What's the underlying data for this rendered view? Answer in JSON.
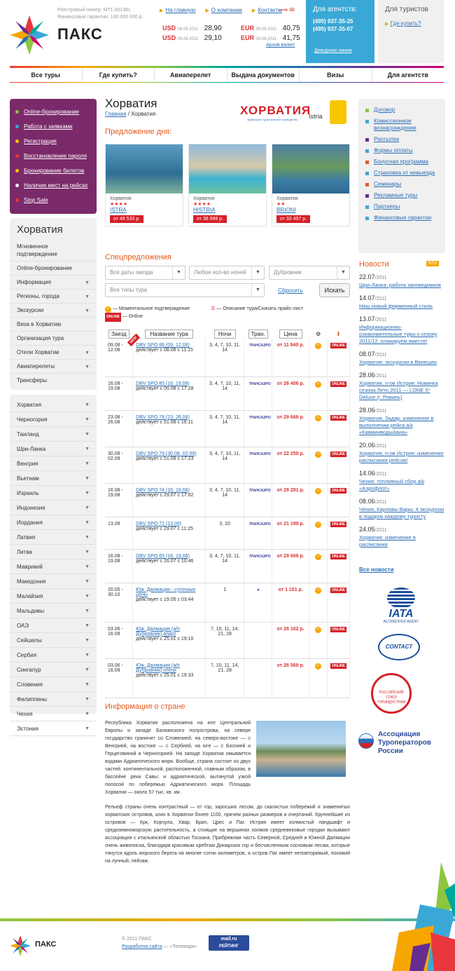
{
  "header": {
    "brand": "ПАКС",
    "reg1": "Реестровый номер: МТ1 001381",
    "reg2": "Финансовые гарантии: 100 000 000 р.",
    "links": [
      "На главную",
      "О компании",
      "Контакты"
    ],
    "rates": [
      {
        "cur": "USD",
        "date": "08.08.2011",
        "val": "28,90"
      },
      {
        "cur": "USD",
        "date": "09.08.2011",
        "val": "29,10"
      },
      {
        "cur": "EUR",
        "date": "08.08.2011",
        "val": "40,75"
      },
      {
        "cur": "EUR",
        "date": "09.08.2011",
        "val": "41,75"
      }
    ],
    "archive": "Архив валют",
    "agency": {
      "title": "Для агентств:",
      "phone1": "(495) 937-35-25",
      "phone2": "(495) 937-35-07",
      "hotline": "Дежурная линия"
    },
    "tourists": {
      "title": "Для туристов",
      "link": "Где купить?"
    }
  },
  "nav": [
    "Все туры",
    "Где купить?",
    "Авиаперелет",
    "Выдача документов",
    "Визы",
    "Для агентств"
  ],
  "leftbox": [
    "Online-бронирование",
    "Работа с заявками",
    "Регистрация",
    "Восстановление пароля",
    "Бронирование билетов",
    "Наличие мест на рейсах",
    "Stop Sale"
  ],
  "country_menu": {
    "title": "Хорватия",
    "items": [
      "Мгновенное подтверждение",
      "Online-бронирование",
      "Информация",
      "Регионы, города",
      "Экскурсии",
      "Виза в Хорватию",
      "Организация тура",
      "Отели Хорватии",
      "Авиаперелеты",
      "Трансферы"
    ]
  },
  "countries": [
    "Хорватия",
    "Черногория",
    "Таиланд",
    "Шри-Ланка",
    "Венгрия",
    "Вьетнам",
    "Израиль",
    "Индонезия",
    "Иордания",
    "Латвия",
    "Литва",
    "Маврикий",
    "Македония",
    "Малайзия",
    "Мальдивы",
    "ОАЭ",
    "Сейшелы",
    "Сербия",
    "Сингапур",
    "Словения",
    "Филиппины",
    "Чехия",
    "Эстония"
  ],
  "main": {
    "title": "Хорватия",
    "crumb_home": "Главная",
    "crumb_sep": "/",
    "crumb_current": "Хорватия",
    "badge1": "ХОРВАТИЯ",
    "badge1_sub": "хорватское туристическое сообщество",
    "badge2": "Istria",
    "offer_title": "Предложение дня:",
    "offers": [
      {
        "country": "Хорватия",
        "stars": "★★★★",
        "name": "ISTRA",
        "price": "от 48 533 р."
      },
      {
        "country": "Хорватия",
        "stars": "★★★★",
        "name": "HISTRIA",
        "price": "от 38 998 р."
      },
      {
        "country": "Хорватия",
        "stars": "★★",
        "name": "BRIONI",
        "price": "от 33 497 р."
      }
    ],
    "special_title": "Спецпредложения",
    "filters": {
      "dates": "Все даты заезда",
      "nights": "Любое кол-во ночей",
      "city": "Дубровник",
      "types": "Все типы тура",
      "reset": "Сбросить",
      "search": "Искать"
    },
    "legend": {
      "instant": "— Моментальное подтверждение",
      "desc": "— Описание тура/Скачать прайс-лист",
      "online": "— Online"
    },
    "table_headers": [
      "Заезд",
      "Название тура",
      "Ночи",
      "Тран.",
      "Цена"
    ],
    "rows": [
      {
        "date": "09.08 - 12.08",
        "tour": "DBV SPO 86 (09. 12.08)",
        "note": "действует с 08.08 с 11:15",
        "nights": "3, 4, 7, 10, 11, 14",
        "air": "ТРАНСАЭРО",
        "price": "от 11 940 р.",
        "check": true
      },
      {
        "date": "16.08 - 19.08",
        "tour": "DBV SPO 85 (16. 19.08)",
        "note": "действует с 05.08 с 17:28",
        "nights": "3, 4, 7, 10, 11, 14",
        "air": "ТРАНСАЭРО",
        "price": "от 26 406 р.",
        "check": true
      },
      {
        "date": "23.08 - 26.08",
        "tour": "DBV SPO 78 (23. 26.08)",
        "note": "действует с 01.08 с 16:11",
        "nights": "3, 4, 7, 10, 11, 14",
        "air": "ТРАНСАЭРО",
        "price": "от 29 666 р.",
        "check": true
      },
      {
        "date": "30.08 - 02.09",
        "tour": "DBV SPO 79 (30.08. 02.09)",
        "note": "действует с 01.08 с 17:23",
        "nights": "3, 4, 7, 10, 11, 14",
        "air": "ТРАНСАЭРО",
        "price": "от 22 250 р.",
        "check": true
      },
      {
        "date": "16.08 - 19.08",
        "tour": "DBV SPO 74 (16. 19.08)",
        "note": "действует с 29.07 с 17:02",
        "nights": "3, 4, 7, 10, 11, 14",
        "air": "ТРАНСАЭРО",
        "price": "от 28 281 р.",
        "check": true
      },
      {
        "date": "13.09",
        "tour": "DBV SPO 71 (13.09)",
        "note": "действует с 29.07 с 11:25",
        "nights": "3, 10",
        "air": "ТРАНСАЭРО",
        "price": "от 21 190 р.",
        "check": true
      },
      {
        "date": "16.08 - 19.08",
        "tour": "DBV SPO 65 (16. 19.08)",
        "note": "действует с 26.07 с 10:46",
        "nights": "3, 4, 7, 10, 11, 14",
        "air": "ТРАНСАЭРО",
        "price": "от 29 666 р.",
        "check": true
      },
      {
        "date": "20.05 - 30.10",
        "tour": "Юж. Далмация - суточные цены",
        "note": "действует с 19.05 с 03:44",
        "nights": "1",
        "air": "✈",
        "price": "от 1 101 р.",
        "check": true
      },
      {
        "date": "03.06 - 16.09",
        "tour": "Юж. Далмация (а/п Дубровник) апарт",
        "note": "действует с 25.01 с 19:10",
        "nights": "7, 10, 11, 14, 21, 28",
        "air": "",
        "price": "от 26 162 р.",
        "check": true
      },
      {
        "date": "03.06 - 16.09",
        "tour": "Юж. Далмация (а/п Дубровник) отели",
        "note": "действует с 25.01 с 19:33",
        "nights": "7, 10, 11, 14, 21, 28",
        "air": "",
        "price": "от 26 569 р.",
        "check": true
      }
    ],
    "online_label": "ONLINE",
    "new_label": "NEW",
    "country_info_title": "Информация о стране",
    "country_text1": "Республика Хорватия расположена на юге Центральной Европы и западе Балканского полуострова, на севере государство граничит со Словенией, на северо-востоке — с Венгрией, на востоке — с Сербией, на юге — с Боснией и Герцеговиной и Черногорией. На западе Хорватия омывается водами Адриатического моря. Вообще, страна состоит из двух частей: континентальной, расположенной, главным образом, в бассейне реки Савы; и адриатической, вытянутой узкой полосой по побережью Адриатического моря. Площадь Хорватии — около 57 тыс. кв. км.",
    "country_text2": "Рельеф страны очень контрастный — от гор, заросших лесом, до скалистых побережий и знаменитых хорватских островов, коих в Хорватии более 1100, причем разных размеров и очертаний. Крупнейшие из островов — Крк, Корчула, Хвар, Брач, Црес и Паг. Истрия имеет холмистый ландшафт и средиземноморскую растительность, а стоящие на вершинах холмов средневековые городки вызывают ассоциации с итальянской областью Тоскана. Прибрежная часть Северной, Средней и Южной Далмации очень живописна, благодаря красивым хребтам Динарских гор и бесчисленным сосновым лесам, которые тянутся вдоль морского берега на многие сотни километров, а остров Паг имеет неповторимый, похожий на лунный, пейзаж."
  },
  "right_links": [
    "Договор",
    "Комиссионное вознаграждение",
    "Рассылка",
    "Формы оплаты",
    "Бонусная программа",
    "Страховка от невыезда",
    "Семинары",
    "Рекламные туры",
    "Партнеры",
    "Финансовые гарантии"
  ],
  "news": {
    "title": "Новости",
    "rss": "RSS",
    "items": [
      {
        "d": "22.07",
        "y": "/2011",
        "t": "Шри-Ланка: работа заповедников"
      },
      {
        "d": "14.07",
        "y": "/2011",
        "t": "Наш новый фирменный стиль"
      },
      {
        "d": "13.07",
        "y": "/2011",
        "t": "Информационно-ознакомительные туры к сезону 2011/12: планируем вместе!"
      },
      {
        "d": "08.07",
        "y": "/2011",
        "t": "Хорватия: экскурсии в Венецию"
      },
      {
        "d": "28.06",
        "y": "/2011",
        "t": "Хорватия, п-ов Истрия: Новинка сезона Лето 2011 — LONE 5* Deluxe (г. Ровинь)"
      },
      {
        "d": "28.06",
        "y": "/2011",
        "t": "Хорватия, Задар: изменение в выполнении рейса а/к «КавминводыАвиа»"
      },
      {
        "d": "20.06",
        "y": "/2011",
        "t": "Хорватия, п-ов Истрия: изменение расписания рейсов!"
      },
      {
        "d": "14.06",
        "y": "/2011",
        "t": "Чехия: топливный сбор а/к «Аэрофлот»"
      },
      {
        "d": "08.06",
        "y": "/2011",
        "t": "Чехия, Карловы Вары: 4 экскурсии в подарок каждому туристу"
      },
      {
        "d": "24.05",
        "y": "/2011",
        "t": "Хорватия: изменение в расписании"
      }
    ],
    "all": "Все новости"
  },
  "logos": {
    "iata": "IATA",
    "iata_sub": "ACCREDITED AGENT",
    "contact": "CONTACT",
    "ator": "Ассоциация Туроператоров России",
    "rst": "РОССИЙСКИЙ СОЮЗ ТУРИНДУСТРИИ"
  },
  "footer": {
    "brand": "ПАКС",
    "copy": "© 2011 ПАКС",
    "dev_link": "Разработка сайта",
    "dev_name": " — «Телемарк»",
    "mailru1": "mail.ru",
    "mailru2": "РЕЙТИНГ"
  },
  "colors": {
    "accent": "#e35a1e",
    "link": "#2a6db5",
    "purple": "#7a2a6a",
    "agency": "#3aa8d6",
    "price": "#d62027"
  }
}
